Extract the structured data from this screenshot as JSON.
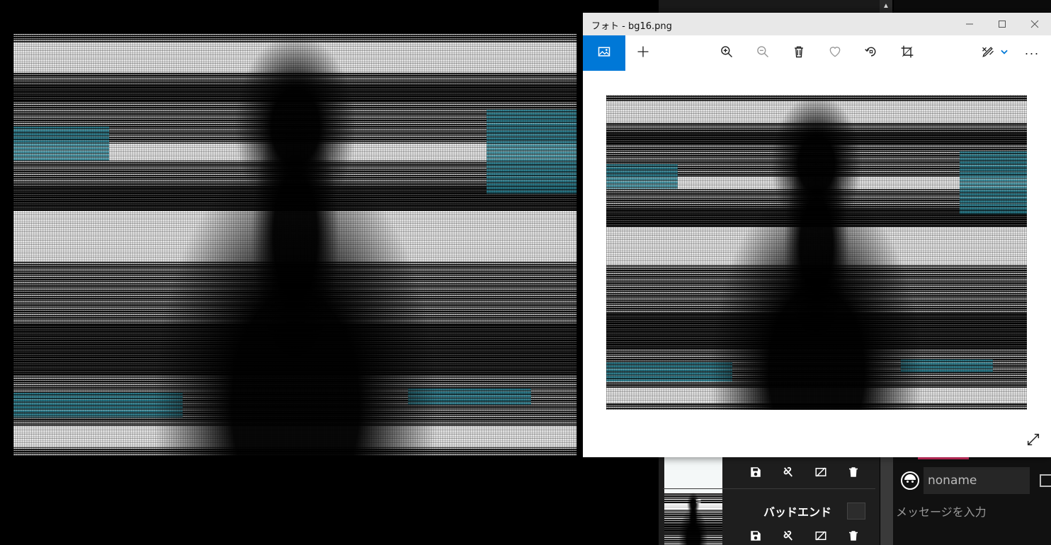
{
  "photos_window": {
    "title": "フォト - bg16.png",
    "toolbar": {
      "view_image_icon": "image-icon",
      "add_icon": "plus-icon",
      "zoom_in_icon": "zoom-in-icon",
      "zoom_out_icon": "zoom-out-icon",
      "delete_icon": "trash-icon",
      "favorite_icon": "heart-icon",
      "rotate_icon": "rotate-icon",
      "crop_icon": "crop-icon",
      "edit_icon": "edit-draw-icon",
      "more_label": "···"
    },
    "image_name": "bg16.png",
    "expand_icon": "fullscreen-icon"
  },
  "background_app": {
    "list_items": [
      {
        "title": "",
        "actions": [
          "save-icon",
          "unlink-icon",
          "hide-image-icon",
          "trash-icon"
        ]
      },
      {
        "title": "バッドエンド",
        "actions": [
          "save-icon",
          "unlink-icon",
          "hide-image-icon",
          "trash-icon"
        ]
      }
    ],
    "drag_handle": "=",
    "chat": {
      "name_placeholder": "noname",
      "message_placeholder": "メッセージを入力"
    },
    "scroll_up_arrow": "▲"
  },
  "colors": {
    "accent_blue": "#0078d7",
    "accent_pink": "#e8336b"
  }
}
